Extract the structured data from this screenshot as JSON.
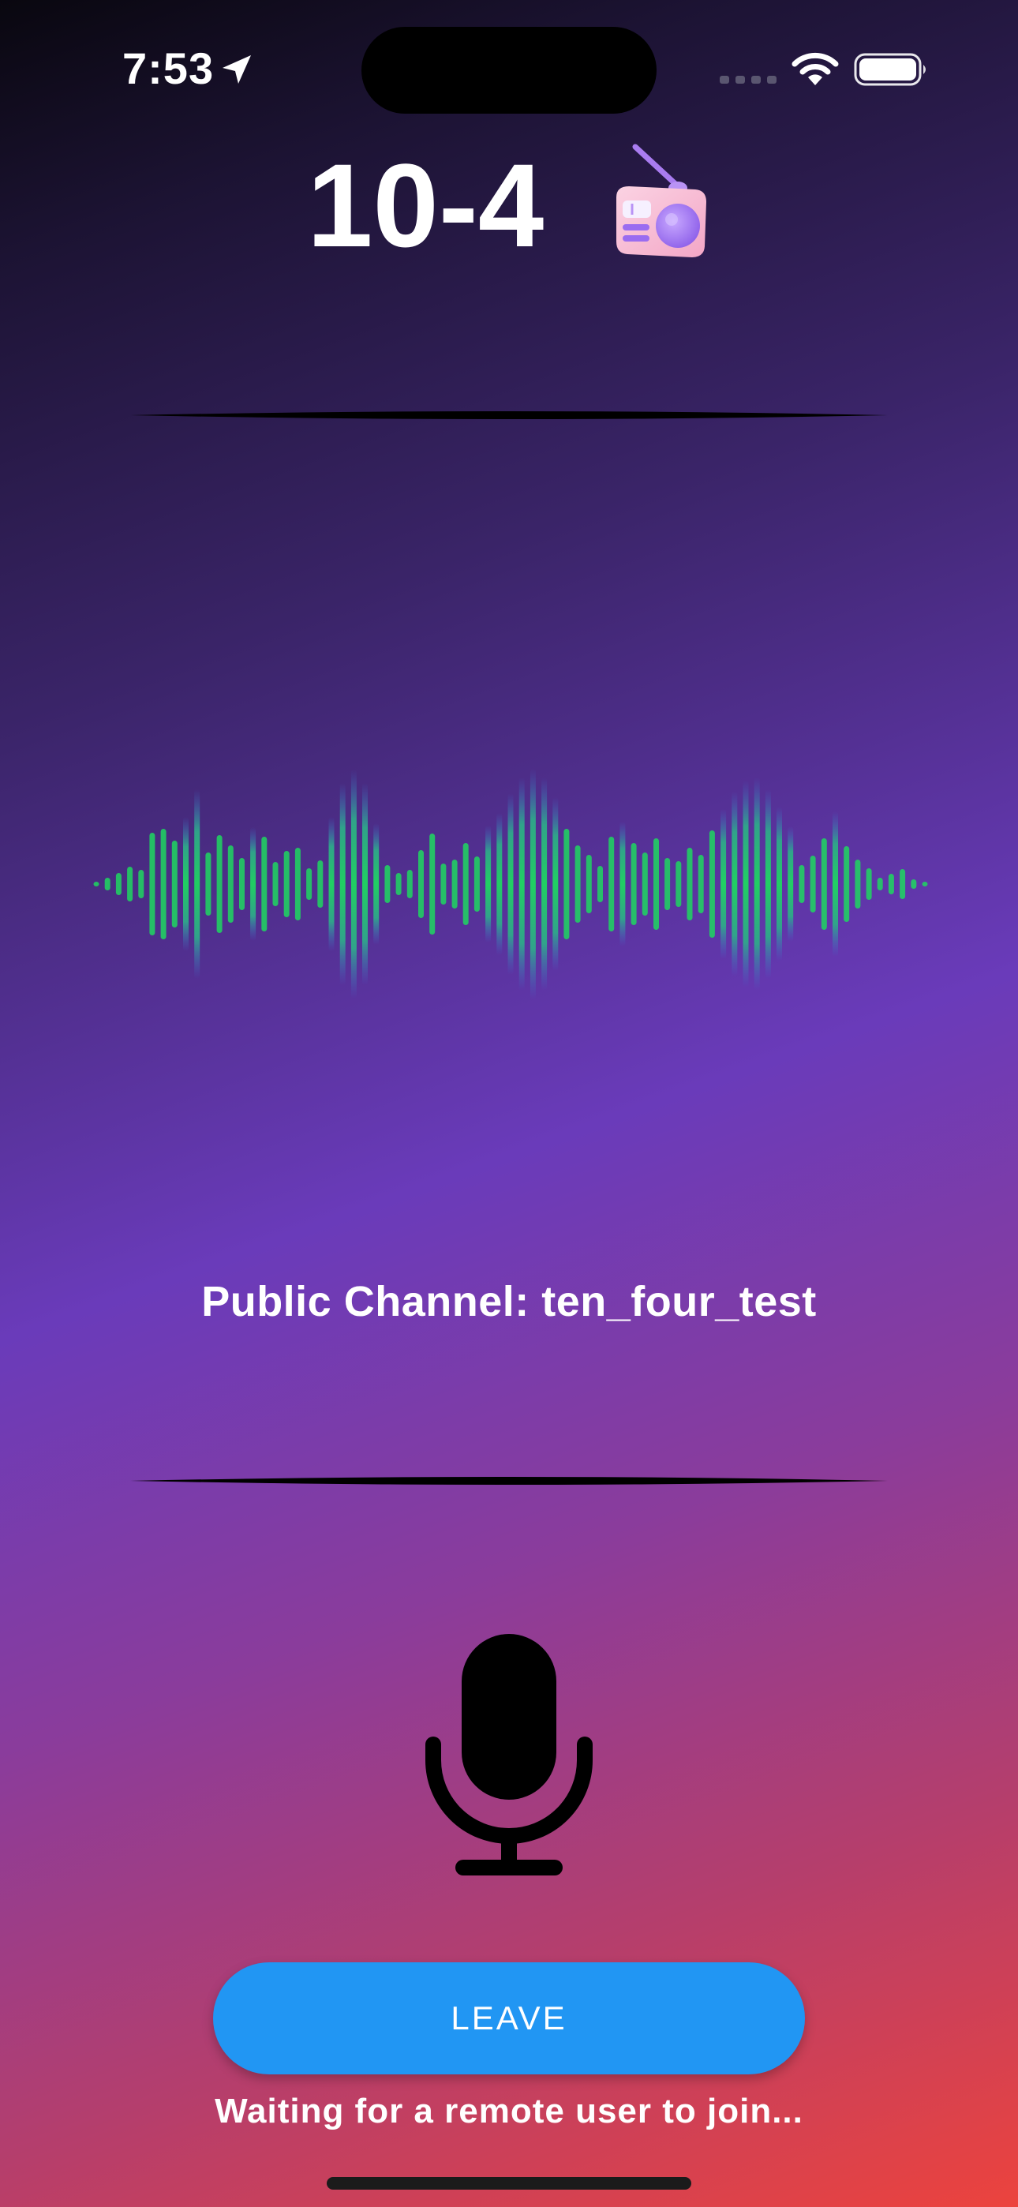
{
  "status_bar": {
    "time": "7:53",
    "icons": [
      "location-arrow-icon",
      "cellular-signal-icon",
      "wifi-icon",
      "battery-icon"
    ]
  },
  "header": {
    "title": "10-4",
    "title_icon": "radio-icon"
  },
  "waveform": {
    "icon": "audio-waveform-icon",
    "colors": {
      "bar_primary": "#1ed760",
      "bar_fade": "#3f6fd4"
    }
  },
  "channel": {
    "label": "Public Channel: ten_four_test"
  },
  "microphone": {
    "icon": "microphone-icon"
  },
  "leave_button": {
    "label": "LEAVE"
  },
  "status": {
    "message": "Waiting for a remote user to join..."
  },
  "colors": {
    "accent": "#2196f3",
    "text": "#ffffff"
  }
}
